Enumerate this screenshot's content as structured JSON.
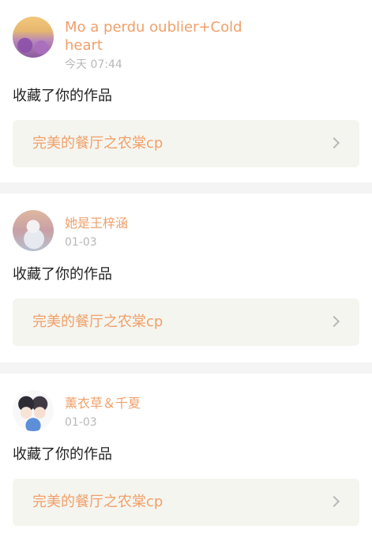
{
  "feed": {
    "items": [
      {
        "name": "Mo a perdu oublier+Cold heart",
        "time": "今天 07:44",
        "action": "收藏了你的作品",
        "work_title": "完美的餐厅之农棠cp"
      },
      {
        "name": "她是王梓涵",
        "time": "01-03",
        "action": "收藏了你的作品",
        "work_title": "完美的餐厅之农棠cp"
      },
      {
        "name": "薰衣草＆千夏",
        "time": "01-03",
        "action": "收藏了你的作品",
        "work_title": "完美的餐厅之农棠cp"
      }
    ]
  },
  "icons": {
    "chevron": "chevron-right-icon"
  },
  "colors": {
    "accent": "#f0a06a",
    "timestamp": "#b8b8b8",
    "box_background": "#f5f5ef",
    "separator": "#f4f4f4"
  }
}
